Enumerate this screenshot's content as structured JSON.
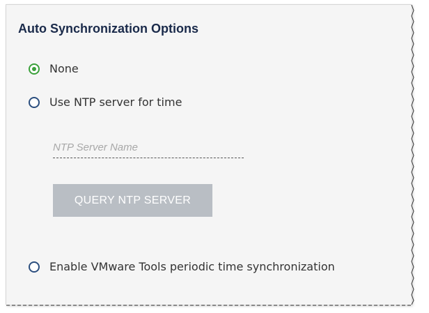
{
  "section": {
    "title": "Auto Synchronization Options"
  },
  "options": [
    {
      "label": "None",
      "selected": true
    },
    {
      "label": "Use NTP server for time",
      "selected": false
    },
    {
      "label": "Enable VMware Tools periodic time synchronization",
      "selected": false
    }
  ],
  "ntp": {
    "placeholder": "NTP Server Name",
    "value": "",
    "query_button_label": "QUERY NTP SERVER",
    "query_button_enabled": false
  },
  "colors": {
    "selected_radio": "#3aa03a",
    "unselected_radio": "#2b4e7e",
    "disabled_button": "#b9bec4",
    "title": "#1a2a4a"
  }
}
